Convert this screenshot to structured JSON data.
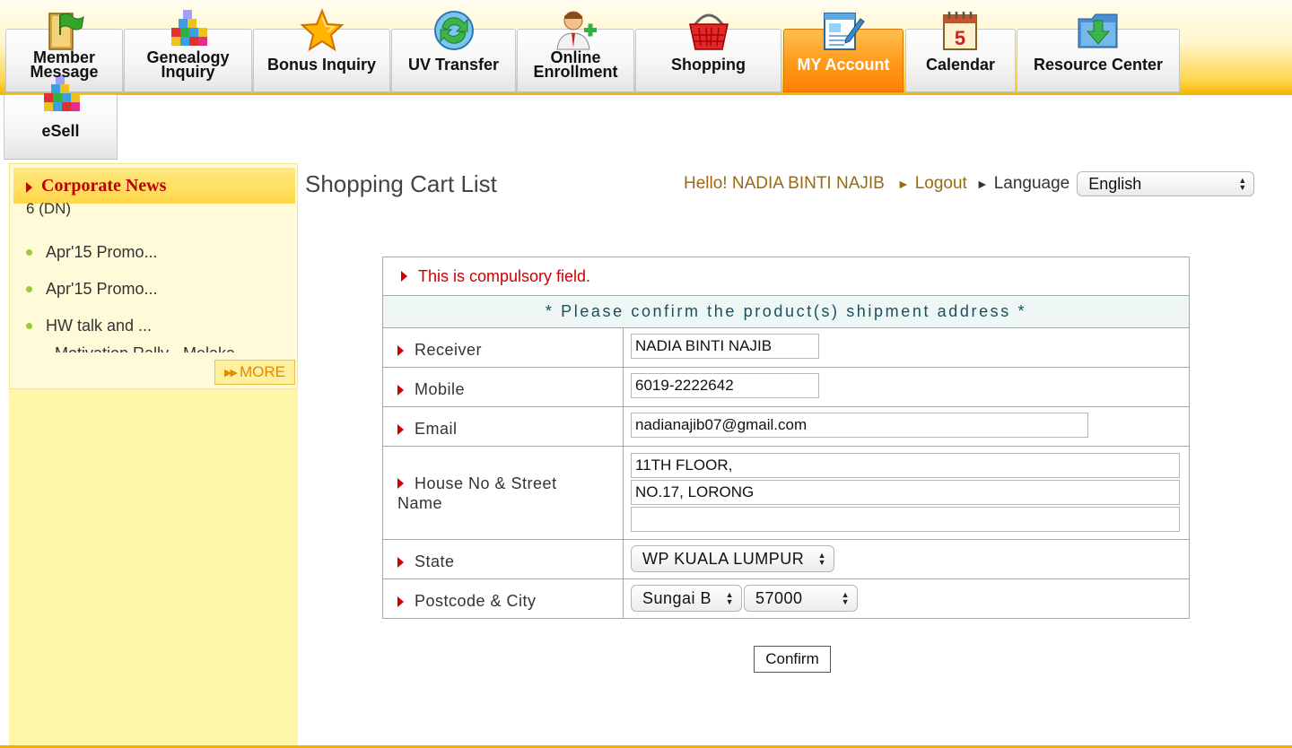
{
  "nav": {
    "tabs": [
      {
        "id": "member-message",
        "label": "Member Message",
        "icon": "flag-icon"
      },
      {
        "id": "genealogy-inquiry",
        "label": "Genealogy Inquiry",
        "icon": "blocks-icon"
      },
      {
        "id": "bonus-inquiry",
        "label": "Bonus Inquiry",
        "icon": "star-icon"
      },
      {
        "id": "uv-transfer",
        "label": "UV Transfer",
        "icon": "refresh-icon"
      },
      {
        "id": "online-enrollment",
        "label": "Online Enrollment",
        "icon": "add-user-icon"
      },
      {
        "id": "shopping",
        "label": "Shopping",
        "icon": "basket-icon"
      },
      {
        "id": "my-account",
        "label": "MY Account",
        "icon": "edit-document-icon",
        "active": true
      },
      {
        "id": "calendar",
        "label": "Calendar",
        "icon": "calendar-icon"
      },
      {
        "id": "resource-center",
        "label": "Resource Center",
        "icon": "download-folder-icon"
      },
      {
        "id": "esell",
        "label": "eSell",
        "icon": "blocks-icon"
      }
    ]
  },
  "sidebar": {
    "title": "Corporate News",
    "stub": "6 (DN)",
    "items": [
      {
        "label": "Apr'15 Promo..."
      },
      {
        "label": "Apr'15 Promo..."
      },
      {
        "label": "HW talk and ..."
      }
    ],
    "clipped_item": "Motivation Rally - Melaka",
    "more_label": "MORE"
  },
  "page": {
    "title": "Shopping Cart List"
  },
  "user": {
    "greeting": "Hello! NADIA BINTI NAJIB",
    "logout_label": "Logout",
    "language_label": "Language",
    "language_value": "English"
  },
  "form": {
    "compulsory_note": "This is compulsory field.",
    "notice": "* Please confirm the product(s) shipment address *",
    "receiver_label": "Receiver",
    "receiver_value": "NADIA BINTI NAJIB",
    "mobile_label": "Mobile",
    "mobile_value": "6019-2222642",
    "email_label": "Email",
    "email_value": "nadianajib07@gmail.com",
    "address_label": "House No & Street Name",
    "address_label_line1": "House No & Street",
    "address_label_line2": "Name",
    "address_line1": "11TH FLOOR,",
    "address_line2": "NO.17, LORONG",
    "address_line3": "",
    "state_label": "State",
    "state_value": "WP KUALA LUMPUR",
    "postcode_city_label": "Postcode & City",
    "city_value": "Sungai B",
    "postcode_value": "57000",
    "confirm_label": "Confirm"
  },
  "colors": {
    "accent_orange": "#ff8a00",
    "header_yellow": "#ffd54a",
    "alert_red": "#cc0000",
    "greeting_brown": "#9a6a10",
    "notice_teal": "#1c4f5c"
  }
}
